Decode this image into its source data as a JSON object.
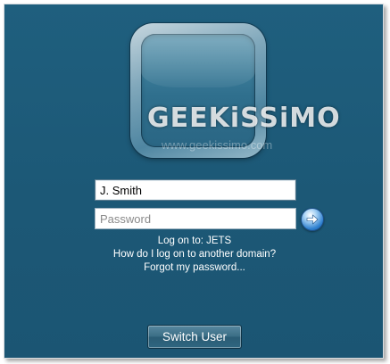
{
  "watermark": {
    "title": "GEEKiSSiMO",
    "url": "www.geekissimo.com"
  },
  "login": {
    "username_value": "J. Smith",
    "password_placeholder": "Password",
    "submit_icon": "arrow-right-icon"
  },
  "links": {
    "logon_to": "Log on to: JETS",
    "other_domain": "How do I log on to another domain?",
    "forgot_password": "Forgot my password..."
  },
  "switch_user_label": "Switch User",
  "colors": {
    "background": "#1d5a78",
    "go_button": "#2d7fcf",
    "text": "#ffffff"
  }
}
